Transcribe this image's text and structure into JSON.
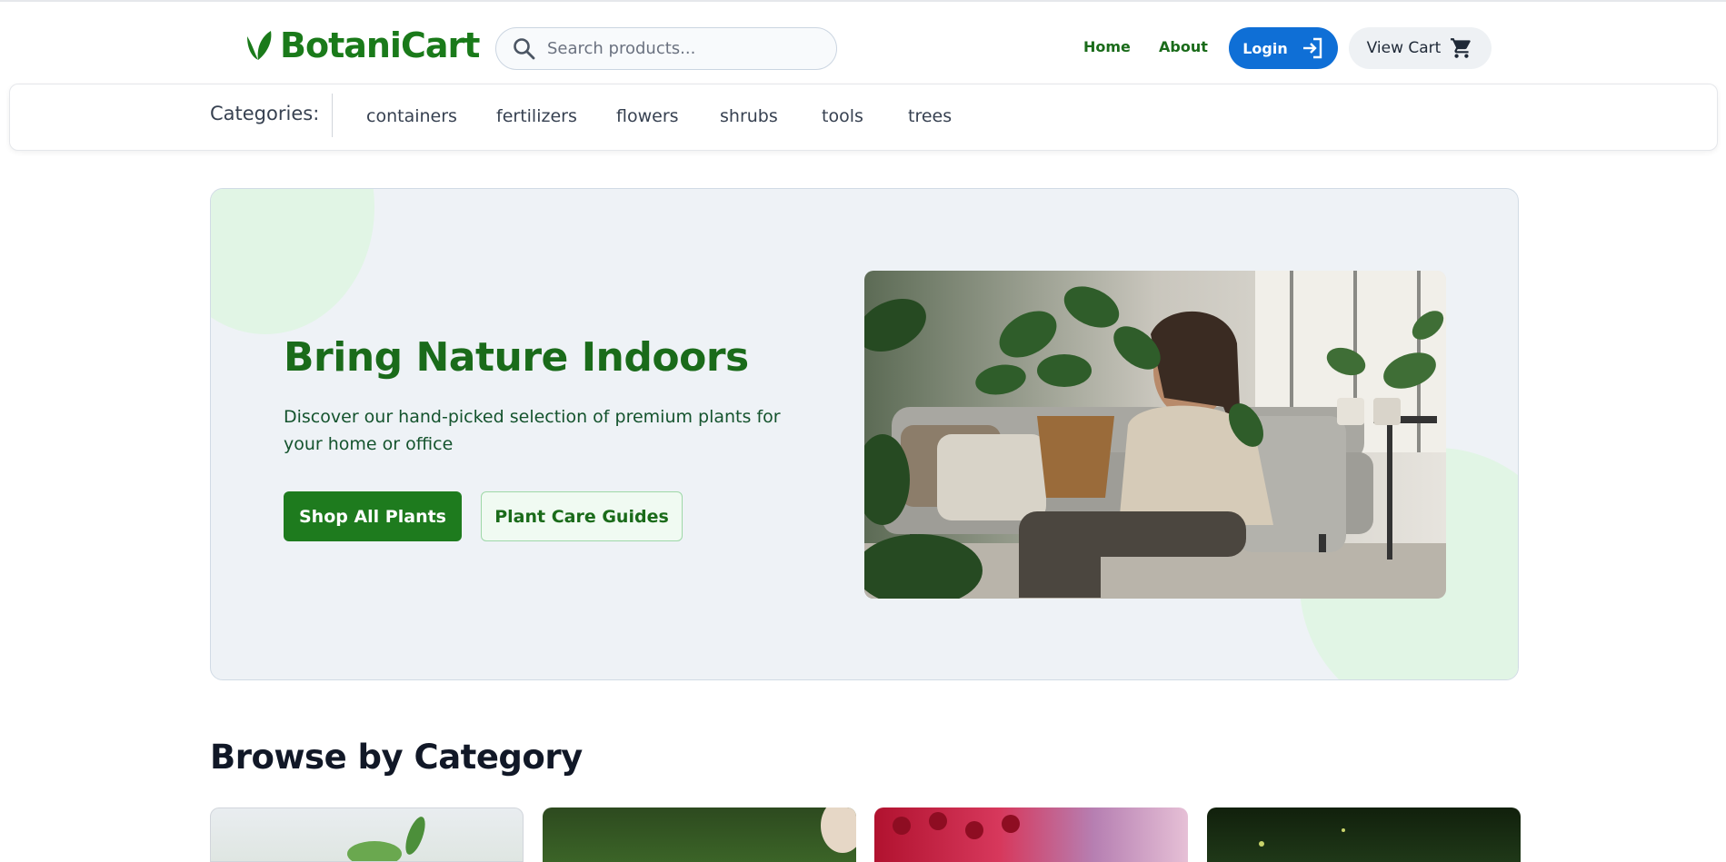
{
  "brand": {
    "name": "BotaniCart",
    "color": "#1a7a1a"
  },
  "search": {
    "placeholder": "Search products..."
  },
  "nav": {
    "home_label": "Home",
    "about_label": "About",
    "login_label": "Login",
    "cart_label": "View Cart"
  },
  "categories": {
    "label": "Categories:",
    "items": [
      "containers",
      "fertilizers",
      "flowers",
      "shrubs",
      "tools",
      "trees"
    ]
  },
  "hero": {
    "title": "Bring Nature Indoors",
    "subtitle": "Discover our hand-picked selection of premium plants for your home or office",
    "primary_button": "Shop All Plants",
    "secondary_button": "Plant Care Guides"
  },
  "browse": {
    "title": "Browse by Category"
  },
  "icons": {
    "logo": "leaf-icon",
    "search": "search-icon",
    "login": "login-arrow-icon",
    "cart": "shopping-cart-icon"
  },
  "colors": {
    "accent_green": "#1e7b1e",
    "login_blue": "#0f6fd6",
    "hero_bg": "#eef2f6"
  }
}
